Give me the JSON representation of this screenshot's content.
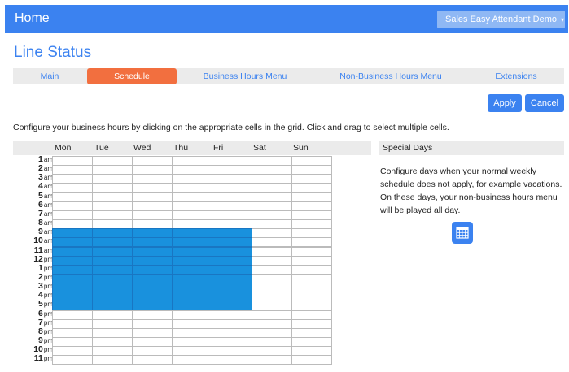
{
  "header": {
    "home_label": "Home",
    "account_label": "Sales Easy Attendant Demo",
    "account_caret": "▾"
  },
  "page_title": "Line Status",
  "tabs": [
    {
      "label": "Main",
      "active": false
    },
    {
      "label": "Schedule",
      "active": true
    },
    {
      "label": "Business Hours Menu",
      "active": false
    },
    {
      "label": "Non-Business Hours Menu",
      "active": false
    },
    {
      "label": "Extensions",
      "active": false
    }
  ],
  "actions": {
    "apply_label": "Apply",
    "cancel_label": "Cancel"
  },
  "instructions": "Configure your business hours by clicking on the appropriate cells in the grid. Click and drag to select multiple cells.",
  "schedule": {
    "days": [
      "Mon",
      "Tue",
      "Wed",
      "Thu",
      "Fri",
      "Sat",
      "Sun"
    ],
    "hours": [
      {
        "num": "1",
        "ampm": "am"
      },
      {
        "num": "2",
        "ampm": "am"
      },
      {
        "num": "3",
        "ampm": "am"
      },
      {
        "num": "4",
        "ampm": "am"
      },
      {
        "num": "5",
        "ampm": "am"
      },
      {
        "num": "6",
        "ampm": "am"
      },
      {
        "num": "7",
        "ampm": "am"
      },
      {
        "num": "8",
        "ampm": "am"
      },
      {
        "num": "9",
        "ampm": "am"
      },
      {
        "num": "10",
        "ampm": "am"
      },
      {
        "num": "11",
        "ampm": "am"
      },
      {
        "num": "12",
        "ampm": "pm"
      },
      {
        "num": "1",
        "ampm": "pm"
      },
      {
        "num": "2",
        "ampm": "pm"
      },
      {
        "num": "3",
        "ampm": "pm"
      },
      {
        "num": "4",
        "ampm": "pm"
      },
      {
        "num": "5",
        "ampm": "pm"
      },
      {
        "num": "6",
        "ampm": "pm"
      },
      {
        "num": "7",
        "ampm": "pm"
      },
      {
        "num": "8",
        "ampm": "pm"
      },
      {
        "num": "9",
        "ampm": "pm"
      },
      {
        "num": "10",
        "ampm": "pm"
      },
      {
        "num": "11",
        "ampm": "pm"
      }
    ],
    "business_days": [
      "Mon",
      "Tue",
      "Wed",
      "Thu",
      "Fri"
    ],
    "business_hours_text": [
      "8 am",
      "5 pm"
    ],
    "business_color": "#1991dd"
  },
  "special_days": {
    "title": "Special Days",
    "description": "Configure days when your normal weekly schedule does not apply, for example vacations. On these days, your non-business hours menu will be played all day.",
    "button_icon": "calendar-icon"
  },
  "colors": {
    "primary": "#3b82f0",
    "active_tab": "#f26f3f",
    "selected_cell": "#1991dd"
  }
}
